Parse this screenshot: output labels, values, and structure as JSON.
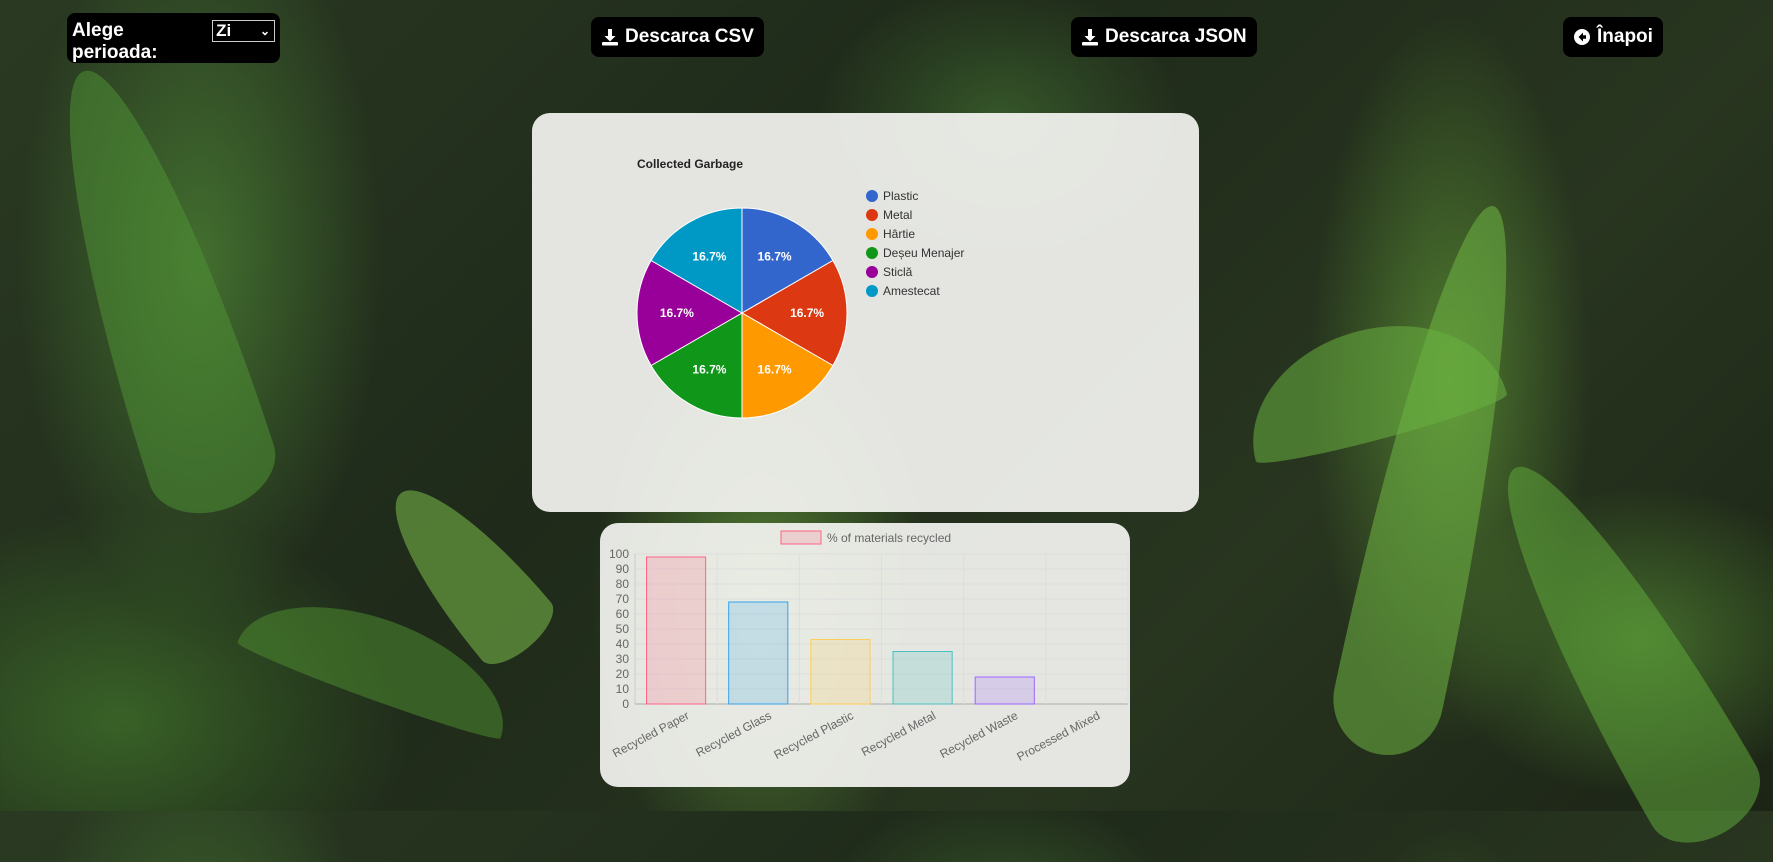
{
  "controls": {
    "period_label": "Alege perioada:",
    "period_value": "Zi",
    "csv_button": "Descarca CSV",
    "json_button": "Descarca JSON",
    "back_button": "Înapoi",
    "icons": {
      "csv": "download-icon",
      "json": "download-icon",
      "back": "arrow-left-circle-icon",
      "select": "chevron-down-icon"
    }
  },
  "chart_data": [
    {
      "type": "pie",
      "title": "Collected Garbage",
      "legend_position": "right",
      "labels": [
        "Plastic",
        "Metal",
        "Hârtie",
        "Deșeu Menajer",
        "Sticlă",
        "Amestecat"
      ],
      "values": [
        16.7,
        16.7,
        16.7,
        16.7,
        16.7,
        16.7
      ],
      "slice_labels": [
        "16.7%",
        "16.7%",
        "16.7%",
        "16.7%",
        "16.7%",
        "16.7%"
      ],
      "colors": [
        "#3366cc",
        "#dc3912",
        "#ff9900",
        "#109618",
        "#990099",
        "#0099c6"
      ]
    },
    {
      "type": "bar",
      "legend": "% of materials recycled",
      "legend_position": "top",
      "categories": [
        "Recycled Paper",
        "Recycled Glass",
        "Recycled Plastic",
        "Recycled Metal",
        "Recycled Waste",
        "Processed Mixed"
      ],
      "values": [
        98,
        68,
        43,
        35,
        18,
        0
      ],
      "ylim": [
        0,
        100
      ],
      "yticks": [
        0,
        10,
        20,
        30,
        40,
        50,
        60,
        70,
        80,
        90,
        100
      ],
      "grid": true,
      "fill_colors": [
        "rgba(255,99,132,0.2)",
        "rgba(54,162,235,0.2)",
        "rgba(255,206,86,0.2)",
        "rgba(75,192,192,0.2)",
        "rgba(153,102,255,0.2)",
        "rgba(255,159,64,0.2)"
      ],
      "border_colors": [
        "rgba(255,99,132,1)",
        "rgba(54,162,235,1)",
        "rgba(255,206,86,1)",
        "rgba(75,192,192,1)",
        "rgba(153,102,255,1)",
        "rgba(255,159,64,1)"
      ]
    }
  ]
}
